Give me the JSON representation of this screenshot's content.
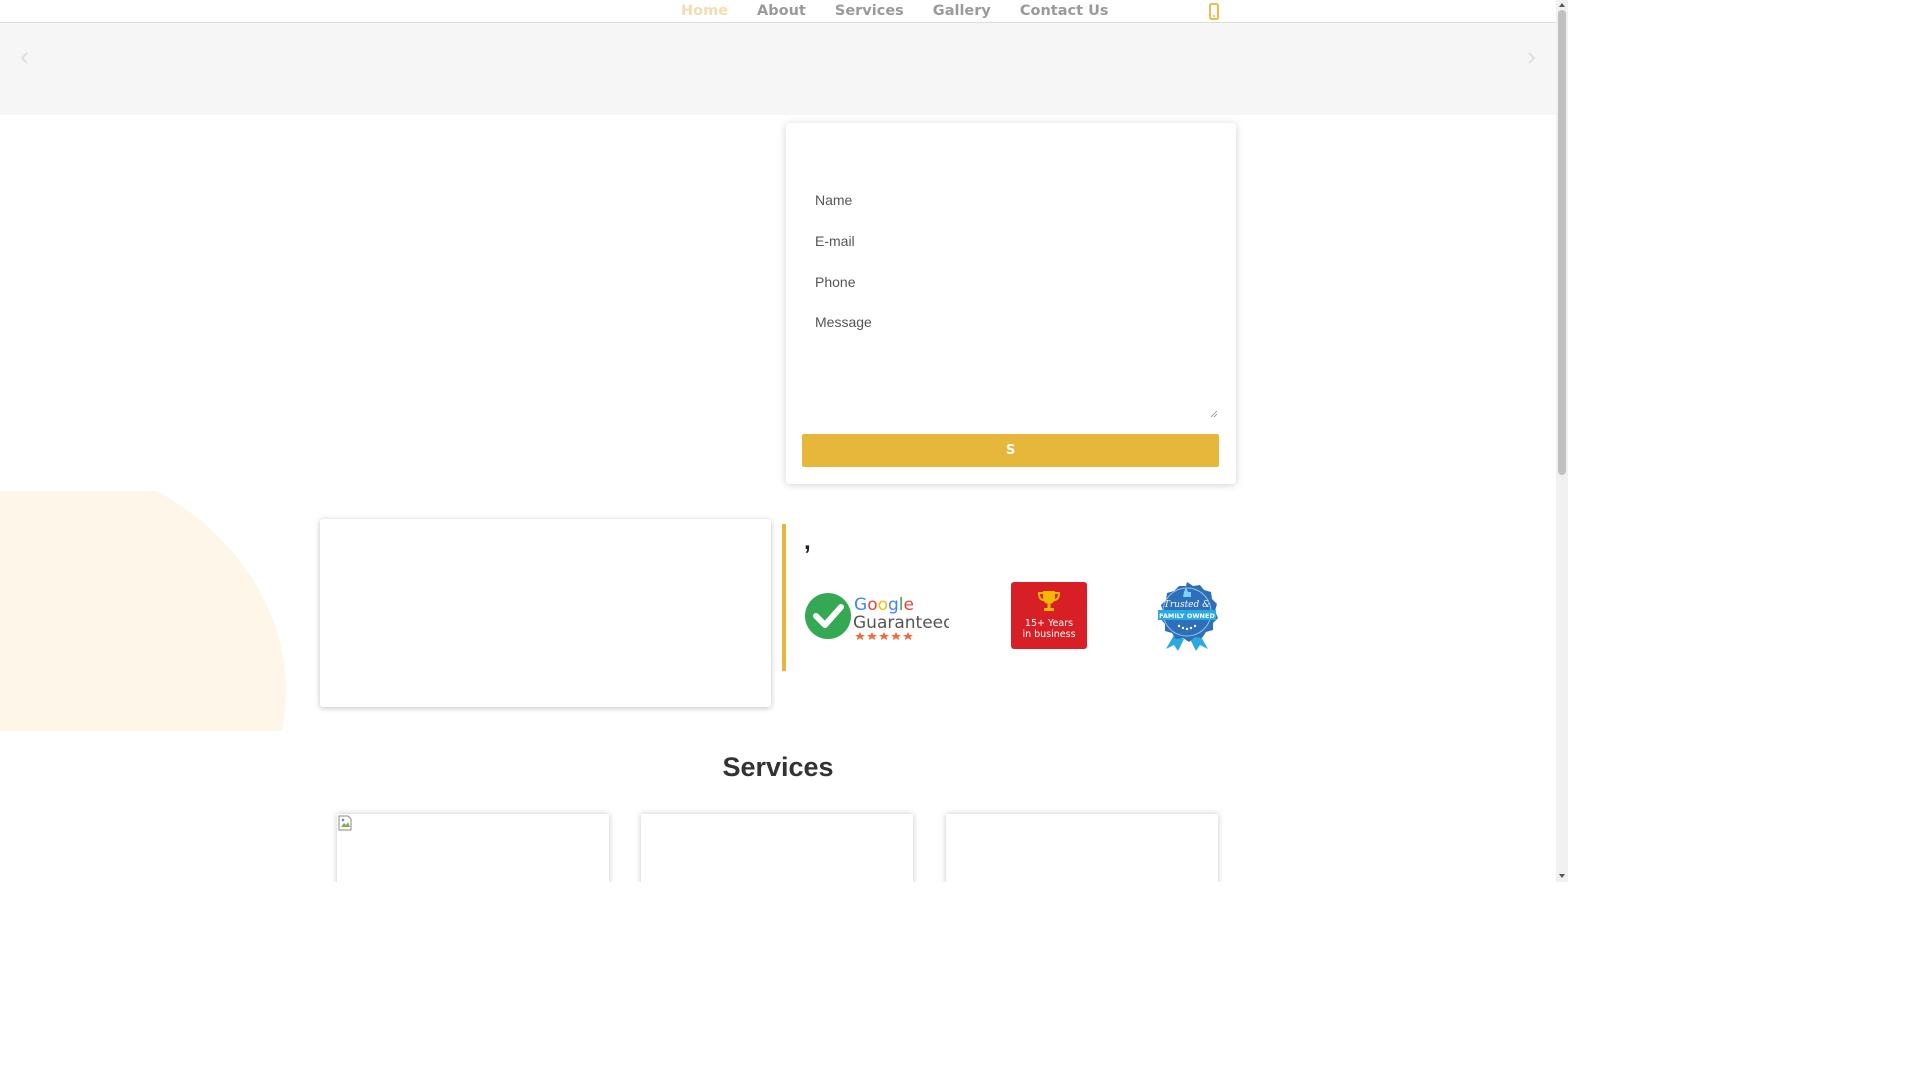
{
  "nav": {
    "items": [
      {
        "label": "Home",
        "active": true
      },
      {
        "label": "About",
        "active": false
      },
      {
        "label": "Services",
        "active": false
      },
      {
        "label": "Gallery",
        "active": false
      },
      {
        "label": "Contact Us",
        "active": false
      }
    ],
    "phone_icon": "mobile-phone-icon"
  },
  "slider": {
    "prev_icon": "chevron-left-icon",
    "next_icon": "chevron-right-icon"
  },
  "contact_form": {
    "name_placeholder": "Name",
    "email_placeholder": "E-mail",
    "phone_placeholder": "Phone",
    "message_placeholder": "Message",
    "submit_label": "S"
  },
  "badges": {
    "comma_text": ",",
    "google": {
      "line1": "Google",
      "line2": "Guaranteed"
    },
    "years": {
      "line1": "15+ Years",
      "line2": "in business"
    },
    "trusted": {
      "line1": "Trusted &",
      "line2": "FAMILY OWNED"
    }
  },
  "services": {
    "title": "Services"
  },
  "colors": {
    "accent": "#e6b73a",
    "nav_active": "#f3ddb0",
    "nav_text": "#9a9a9a",
    "blob": "#fef7e9",
    "badge_red": "#d81f26",
    "badge_blue": "#2d6fb8"
  }
}
